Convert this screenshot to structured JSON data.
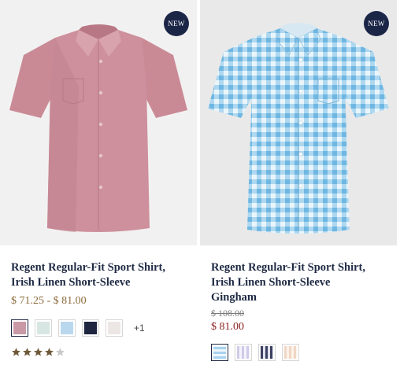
{
  "products": [
    {
      "badge": "NEW",
      "title_line1": "Regent Regular-Fit Sport Shirt,",
      "title_line2": "Irish Linen Short-Sleeve",
      "price_range": "$ 71.25 - $ 81.00",
      "shirt_color": "#c98a96",
      "swatches": [
        {
          "name": "pink",
          "color": "#c99aa6"
        },
        {
          "name": "mint",
          "color": "#d7e6e3"
        },
        {
          "name": "light-blue",
          "color": "#b9d8ee"
        },
        {
          "name": "navy",
          "color": "#1e2640"
        },
        {
          "name": "white",
          "color": "#ece7e5"
        }
      ],
      "more_swatches": "+1",
      "rating_stars": 4
    },
    {
      "badge": "NEW",
      "title_line1": "Regent Regular-Fit Sport Shirt,",
      "title_line2": "Irish Linen Short-Sleeve",
      "title_line3": "Gingham",
      "price_original": "$ 108.00",
      "price_sale": "$ 81.00",
      "shirt_color": "#8dcbeb",
      "swatches": [
        {
          "name": "blue-gingham",
          "color": "#a6d3ef"
        },
        {
          "name": "lavender-gingham",
          "color": "#d9d7ee"
        },
        {
          "name": "navy-gingham",
          "color": "#5a5f7e"
        },
        {
          "name": "peach-gingham",
          "color": "#f1ddcd"
        }
      ]
    }
  ],
  "colors": {
    "badge_bg": "#1b2647",
    "star": "#6f5a3a",
    "price": "#8b6a3a",
    "sale": "#8a1f1f"
  }
}
